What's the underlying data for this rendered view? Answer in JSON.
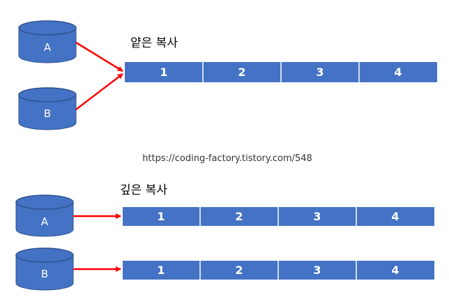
{
  "colors": {
    "cylinder_fill": "#4472C4",
    "cylinder_stroke": "#2F528F",
    "array_fill": "#4472C4",
    "divider": "#ffffff",
    "arrow": "#ff0000",
    "text": "#000000",
    "background": "#ffffff"
  },
  "shallow_copy": {
    "title": "얕은 복사",
    "variables": [
      "A",
      "B"
    ],
    "array": [
      "1",
      "2",
      "3",
      "4"
    ]
  },
  "source_url": "https://coding-factory.tistory.com/548",
  "deep_copy": {
    "title": "깊은 복사",
    "variables": [
      "A",
      "B"
    ],
    "arrays": [
      [
        "1",
        "2",
        "3",
        "4"
      ],
      [
        "1",
        "2",
        "3",
        "4"
      ]
    ]
  }
}
